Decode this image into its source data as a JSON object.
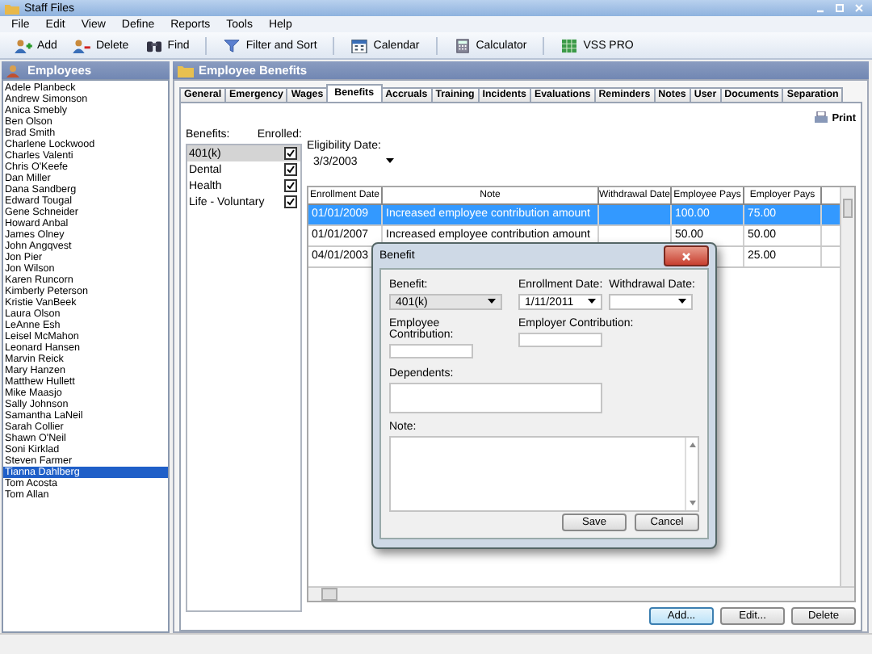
{
  "window": {
    "title": "Staff Files"
  },
  "menu": [
    "File",
    "Edit",
    "View",
    "Define",
    "Reports",
    "Tools",
    "Help"
  ],
  "toolbar": [
    [
      {
        "label": "Add",
        "kind": "add"
      },
      {
        "label": "Delete",
        "kind": "delete"
      },
      {
        "label": "Find",
        "kind": "find"
      }
    ],
    [
      {
        "label": "Filter and Sort",
        "kind": "filter"
      }
    ],
    [
      {
        "label": "Calendar",
        "kind": "calendar"
      }
    ],
    [
      {
        "label": "Calculator",
        "kind": "calculator"
      }
    ],
    [
      {
        "label": "VSS PRO",
        "kind": "vss"
      }
    ]
  ],
  "employees": {
    "title": "Employees",
    "items": [
      {
        "name": "Adele Planbeck",
        "selected": false
      },
      {
        "name": "Andrew Simonson",
        "selected": false
      },
      {
        "name": "Anica Smebly",
        "selected": false
      },
      {
        "name": "Ben Olson",
        "selected": false
      },
      {
        "name": "Brad Smith",
        "selected": false
      },
      {
        "name": "Charlene Lockwood",
        "selected": false
      },
      {
        "name": "Charles Valenti",
        "selected": false
      },
      {
        "name": "Chris O'Keefe",
        "selected": false
      },
      {
        "name": "Dan Miller",
        "selected": false
      },
      {
        "name": "Dana Sandberg",
        "selected": false
      },
      {
        "name": "Edward Tougal",
        "selected": false
      },
      {
        "name": "Gene Schneider",
        "selected": false
      },
      {
        "name": "Howard Anbal",
        "selected": false
      },
      {
        "name": "James Olney",
        "selected": false
      },
      {
        "name": "John Angqvest",
        "selected": false
      },
      {
        "name": "Jon Pier",
        "selected": false
      },
      {
        "name": "Jon Wilson",
        "selected": false
      },
      {
        "name": "Karen Runcorn",
        "selected": false
      },
      {
        "name": "Kimberly Peterson",
        "selected": false
      },
      {
        "name": "Kristie VanBeek",
        "selected": false
      },
      {
        "name": "Laura Olson",
        "selected": false
      },
      {
        "name": "LeAnne Esh",
        "selected": false
      },
      {
        "name": "Leisel McMahon",
        "selected": false
      },
      {
        "name": "Leonard Hansen",
        "selected": false
      },
      {
        "name": "Marvin Reick",
        "selected": false
      },
      {
        "name": "Mary Hanzen",
        "selected": false
      },
      {
        "name": "Matthew Hullett",
        "selected": false
      },
      {
        "name": "Mike Maasjo",
        "selected": false
      },
      {
        "name": "Sally Johnson",
        "selected": false
      },
      {
        "name": "Samantha LaNeil",
        "selected": false
      },
      {
        "name": "Sarah Collier",
        "selected": false
      },
      {
        "name": "Shawn O'Neil",
        "selected": false
      },
      {
        "name": "Soni Kirklad",
        "selected": false
      },
      {
        "name": "Steven Farmer",
        "selected": false
      },
      {
        "name": "Tianna Dahlberg",
        "selected": true
      },
      {
        "name": "Tom Acosta",
        "selected": false
      },
      {
        "name": "Tom Allan",
        "selected": false
      }
    ]
  },
  "benefits_panel": {
    "title": "Employee Benefits",
    "tabs": [
      {
        "label": "General",
        "selected": false
      },
      {
        "label": "Emergency",
        "selected": false
      },
      {
        "label": "Wages",
        "selected": false
      },
      {
        "label": "Benefits",
        "selected": true
      },
      {
        "label": "Accruals",
        "selected": false
      },
      {
        "label": "Training",
        "selected": false
      },
      {
        "label": "Incidents",
        "selected": false
      },
      {
        "label": "Evaluations",
        "selected": false
      },
      {
        "label": "Reminders",
        "selected": false
      },
      {
        "label": "Notes",
        "selected": false
      },
      {
        "label": "User",
        "selected": false
      },
      {
        "label": "Documents",
        "selected": false
      },
      {
        "label": "Separation",
        "selected": false
      }
    ],
    "print": "Print",
    "benefits_label": "Benefits:",
    "enrolled_label": "Enrolled:",
    "benefits": [
      {
        "name": "401(k)",
        "enrolled": true,
        "selected": true
      },
      {
        "name": "Dental",
        "enrolled": true,
        "selected": false
      },
      {
        "name": "Health",
        "enrolled": true,
        "selected": false
      },
      {
        "name": "Life - Voluntary",
        "enrolled": true,
        "selected": false
      }
    ],
    "eligibility_label": "Eligibility Date:",
    "eligibility_date": "3/3/2003",
    "table": {
      "columns": [
        "Enrollment Date",
        "Note",
        "Withdrawal Date",
        "Employee Pays",
        "Employer Pays"
      ],
      "rows": [
        {
          "selected": true,
          "cells": [
            "01/01/2009",
            "Increased employee contribution amount",
            null,
            "100.00",
            "75.00"
          ]
        },
        {
          "selected": false,
          "cells": [
            "01/01/2007",
            "Increased employee contribution amount",
            null,
            "50.00",
            "50.00"
          ]
        },
        {
          "selected": false,
          "cells": [
            "04/01/2003",
            null,
            null,
            null,
            "25.00"
          ]
        }
      ]
    },
    "buttons": [
      {
        "label": "Add...",
        "focused": true
      },
      {
        "label": "Edit...",
        "focused": false
      },
      {
        "label": "Delete",
        "focused": false
      }
    ]
  },
  "dialog": {
    "title": "Benefit",
    "benefit_label": "Benefit:",
    "benefit": "401(k)",
    "enrollment_label": "Enrollment Date:",
    "enrollment_date": "1/11/2011",
    "withdrawal_label": "Withdrawal Date:",
    "employee_contribution_label": "Employee Contribution:",
    "employer_contribution_label": "Employer Contribution:",
    "dependents_label": "Dependents:",
    "note_label": "Note:",
    "buttons": [
      "Save",
      "Cancel"
    ]
  }
}
